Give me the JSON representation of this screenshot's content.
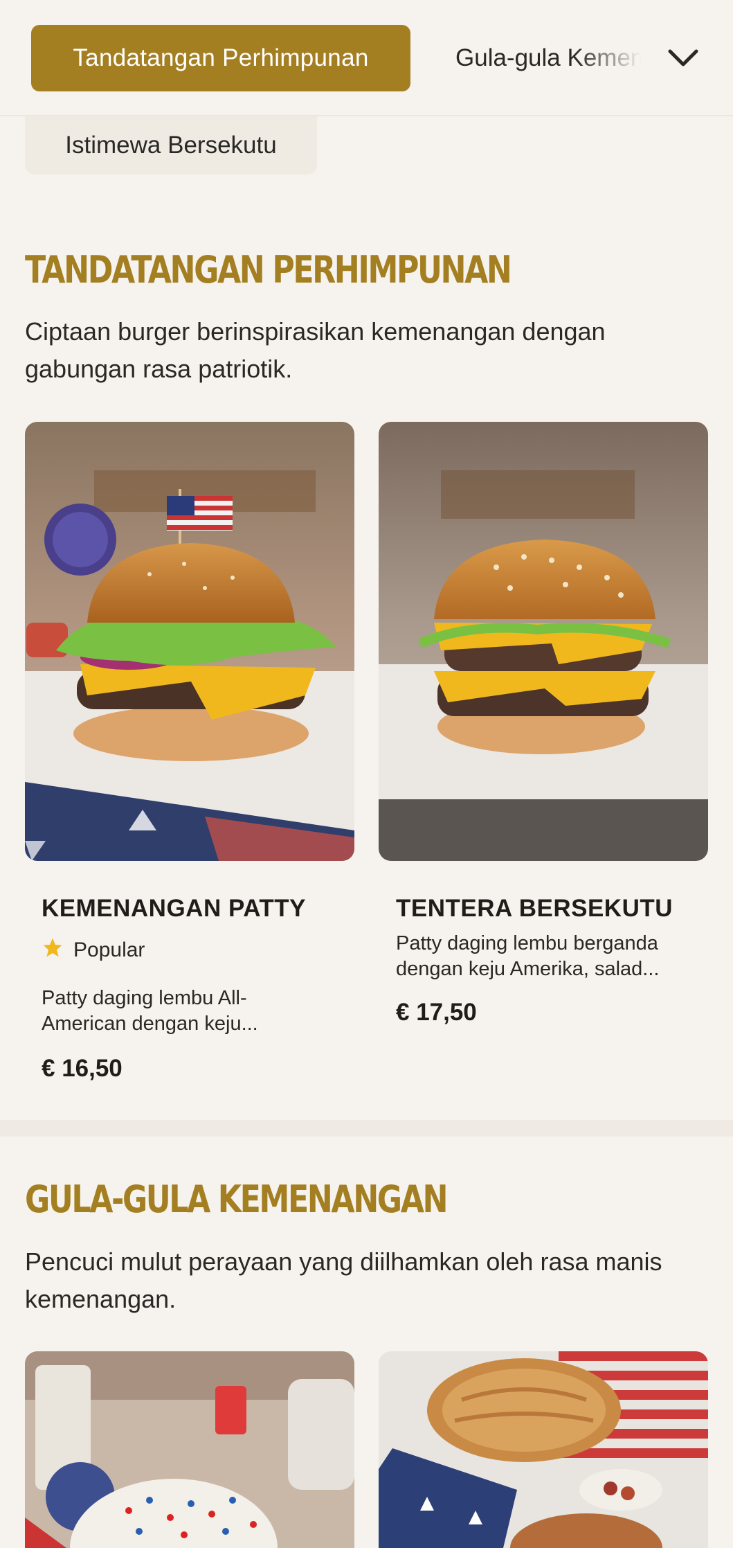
{
  "nav": {
    "active_category": "Tandatangan Perhimpunan",
    "next_category": "Gula-gula Kemenangan",
    "prev_chip": "Istimewa Bersekutu",
    "toggle_icon": "chevron-down-icon"
  },
  "sections": [
    {
      "title": "Tandatangan Perhimpunan",
      "description": "Ciptaan burger berinspirasikan kemenangan dengan gabungan rasa patriotik.",
      "items": [
        {
          "name": "KEMENANGAN PATTY",
          "badge": "Popular",
          "badge_icon": "star-icon",
          "description": "Patty daging lembu All-American dengan keju...",
          "price": "€ 16,50"
        },
        {
          "name": "TENTERA BERSEKUTU",
          "description": "Patty daging lembu berganda dengan keju Amerika, salad...",
          "price": "€ 17,50"
        }
      ]
    },
    {
      "title": "Gula-gula Kemenangan",
      "description": "Pencuci mulut perayaan yang diilhamkan oleh rasa manis kemenangan."
    }
  ],
  "colors": {
    "accent": "#a47f22",
    "background": "#f6f3ee",
    "text": "#1f1d1a",
    "star": "#f1b81e"
  }
}
